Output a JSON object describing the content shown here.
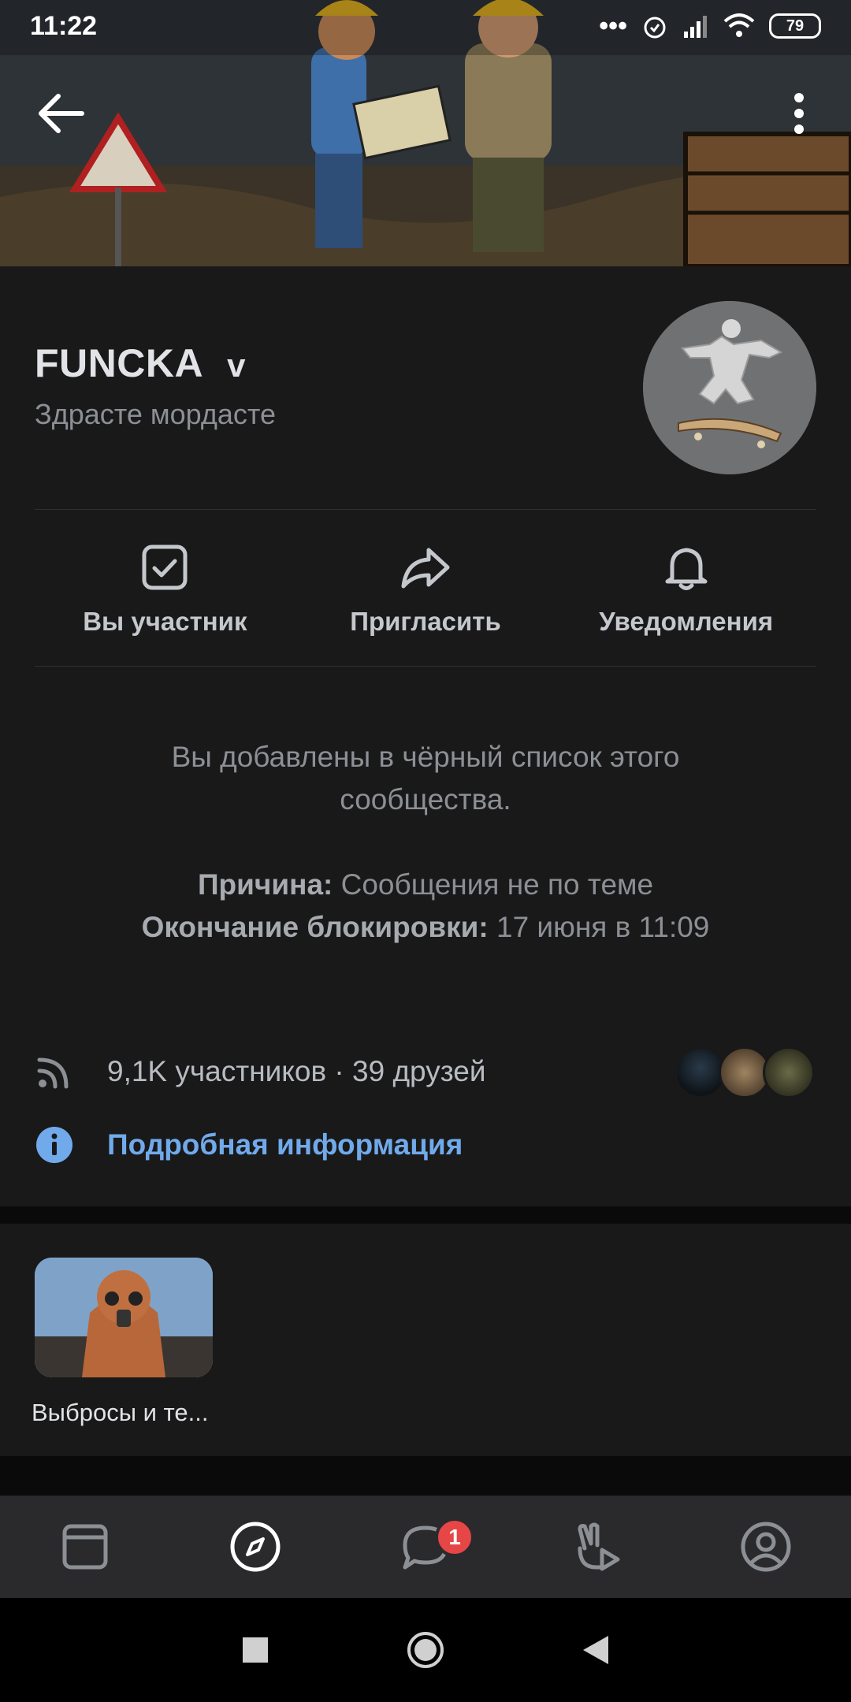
{
  "status_bar": {
    "time": "11:22",
    "battery": "79"
  },
  "community": {
    "name": "FUNCKA",
    "name_badge": "v",
    "status": "Здрасте мордасте"
  },
  "actions": [
    {
      "label": "Вы участник",
      "icon": "checkbox-icon"
    },
    {
      "label": "Пригласить",
      "icon": "share-arrow-icon"
    },
    {
      "label": "Уведомления",
      "icon": "bell-icon"
    }
  ],
  "blacklist_notice": {
    "line1": "Вы добавлены в чёрный список этого",
    "line2": "сообщества.",
    "reason_label": "Причина:",
    "reason_value": " Сообщения не по теме",
    "end_label": "Окончание блокировки:",
    "end_value": " 17 июня в 11:09"
  },
  "members": {
    "text": "9,1K участников · 39 друзей"
  },
  "info": {
    "text": "Подробная информация"
  },
  "sections": [
    {
      "label": "Выбросы и те..."
    }
  ],
  "tabbar": {
    "items": [
      "feed-icon",
      "explore-compass-icon",
      "messages-icon",
      "clips-icon",
      "profile-icon"
    ],
    "messages_badge": "1",
    "active_index": 1
  },
  "colors": {
    "accent": "#71aaeb",
    "badge": "#e64646",
    "background": "#19191a"
  }
}
